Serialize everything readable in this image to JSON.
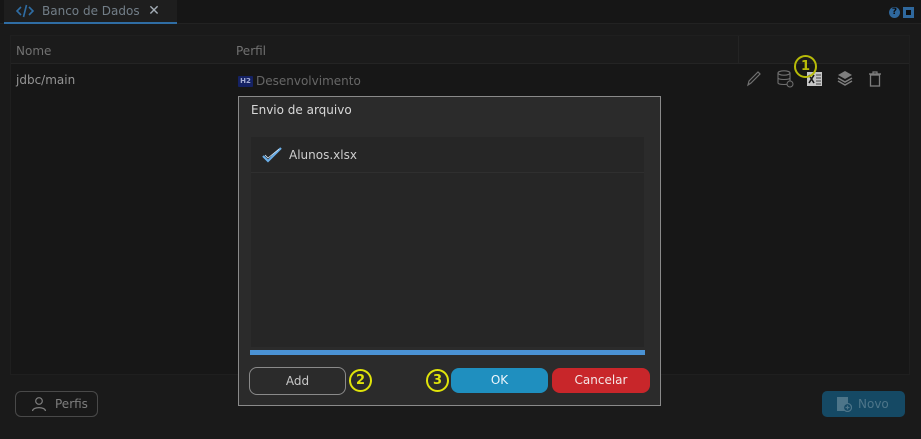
{
  "tab": {
    "title": "Banco de Dados",
    "close": "✕",
    "icon": "code-icon"
  },
  "header_icons": {
    "help": "?",
    "help_icon": "help-icon",
    "panel_icon": "panel-icon"
  },
  "table": {
    "columns": [
      "Nome",
      "Perfil"
    ],
    "rows": [
      {
        "name": "jdbc/main",
        "profile_badge": "H2",
        "profile": "Desenvolvimento"
      }
    ],
    "row_actions": [
      "pencil-icon",
      "database-icon",
      "excel-icon",
      "layers-icon",
      "trash-icon"
    ]
  },
  "annotations": {
    "one": "1",
    "two": "2",
    "three": "3"
  },
  "footer": {
    "perfis": "Perfis",
    "novo": "Novo",
    "perfis_icon": "user-icon",
    "novo_icon": "database-add-icon"
  },
  "modal": {
    "title": "Envio de arquivo",
    "files": [
      {
        "name": "Alunos.xlsx",
        "status_icon": "check-icon"
      }
    ],
    "progress": 1.0,
    "add": "Add",
    "ok": "OK",
    "cancel": "Cancelar"
  },
  "colors": {
    "accent": "#3a86c8",
    "ok": "#1f8fbf",
    "cancel": "#c8262a",
    "annotation": "#e0e40a",
    "progress": "#4a92d4"
  }
}
